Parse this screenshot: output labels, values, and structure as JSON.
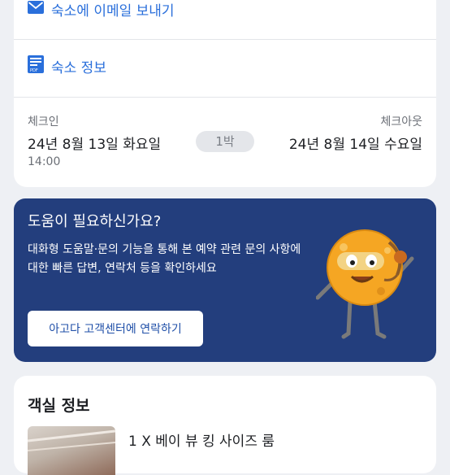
{
  "property": {
    "email_label": "숙소에 이메일 보내기",
    "info_label": "숙소 정보",
    "pdf_badge": "PDF"
  },
  "stay": {
    "checkin_label": "체크인",
    "checkin_date": "24년 8월 13일 화요일",
    "checkin_time": "14:00",
    "nights": "1박",
    "checkout_label": "체크아웃",
    "checkout_date": "24년 8월 14일 수요일"
  },
  "help": {
    "title": "도움이 필요하신가요?",
    "body": "대화형 도움말·문의 기능을 통해 본 예약 관련 문의 사항에 대한 빠른 답변, 연락처 등을 확인하세요",
    "button": "아고다 고객센터에 연락하기"
  },
  "room": {
    "section_title": "객실 정보",
    "name": "1 X 베이 뷰 킹 사이즈 룸"
  },
  "colors": {
    "link": "#2a6fdb",
    "help_bg": "#233e7d",
    "mascot": "#f5a623"
  }
}
